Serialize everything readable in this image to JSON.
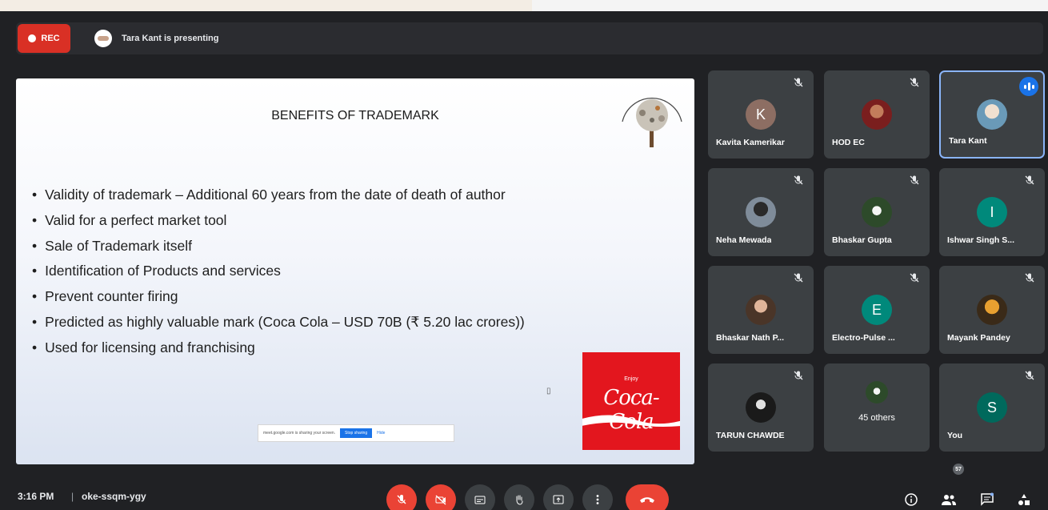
{
  "recording": {
    "label": "REC"
  },
  "presenter": {
    "text": "Tara Kant is presenting"
  },
  "slide": {
    "title": "BENEFITS OF TRADEMARK",
    "bullets": [
      "Validity of trademark – Additional 60 years from the date of death of author",
      "Valid for a perfect market tool",
      "Sale of Trademark itself",
      "Identification of Products and services",
      "Prevent counter firing",
      "Predicted as highly valuable mark (Coca Cola – USD 70B (₹ 5.20 lac crores))",
      "Used for licensing and franchising"
    ],
    "coke_top": "Enjoy",
    "coke_logo": "Coca-Cola",
    "share_notice": {
      "text": "meet.google.com is sharing your screen.",
      "stop": "Stop sharing",
      "hide": "Hide"
    }
  },
  "participants": [
    {
      "name": "Kavita Kamerikar",
      "initial": "K",
      "avatar_color": "#8d6e63",
      "muted": true
    },
    {
      "name": "HOD EC",
      "photo": true,
      "muted": true
    },
    {
      "name": "Tara Kant",
      "photo": true,
      "speaking": true,
      "active": true
    },
    {
      "name": "Neha Mewada",
      "photo": true,
      "muted": true
    },
    {
      "name": "Bhaskar Gupta",
      "photo": true,
      "muted": true
    },
    {
      "name": "Ishwar Singh S...",
      "initial": "I",
      "avatar_color": "#00897b",
      "muted": true
    },
    {
      "name": "Bhaskar Nath P...",
      "photo": true,
      "muted": true
    },
    {
      "name": "Electro-Pulse ...",
      "initial": "E",
      "avatar_color": "#00897b",
      "muted": true
    },
    {
      "name": "Mayank Pandey",
      "photo": true,
      "muted": true
    },
    {
      "name": "TARUN CHAWDE",
      "photo": true,
      "muted": true
    },
    {
      "name": "45 others",
      "others": true
    },
    {
      "name": "You",
      "initial": "S",
      "avatar_color": "#00695c",
      "muted": true
    }
  ],
  "bottom": {
    "time": "3:16 PM",
    "separator": "|",
    "meeting_code": "oke-ssqm-ygy",
    "people_count": "57"
  },
  "colors": {
    "record": "#d93025",
    "end_call": "#ea4335",
    "tile": "#3c4043",
    "background": "#202124",
    "accent": "#1a73e8"
  },
  "icons": [
    "mic-off-icon",
    "camera-off-icon",
    "captions-icon",
    "raise-hand-icon",
    "present-icon",
    "more-options-icon",
    "end-call-icon",
    "info-icon",
    "people-icon",
    "chat-icon",
    "activities-icon"
  ]
}
